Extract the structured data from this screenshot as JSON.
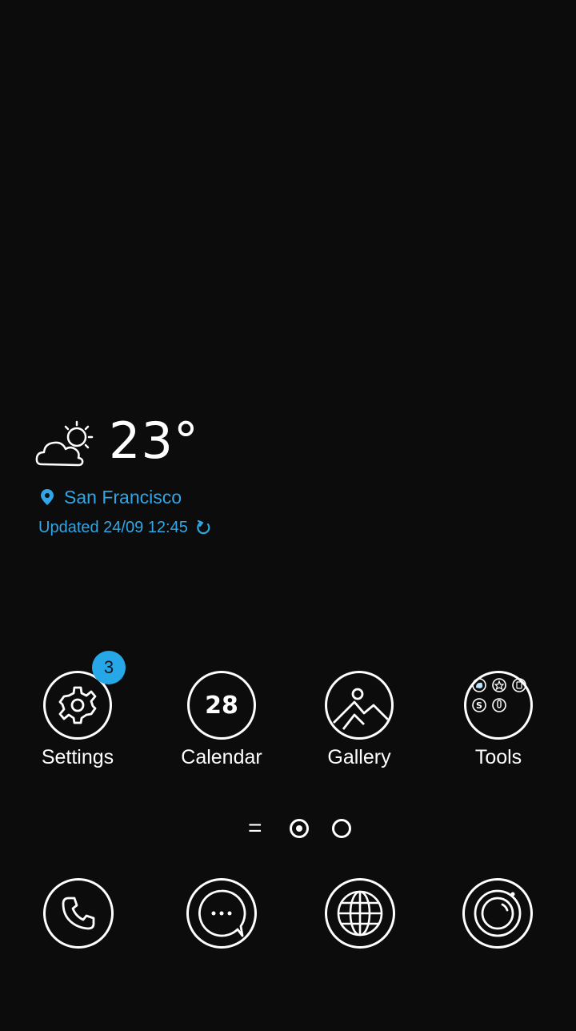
{
  "weather": {
    "temperature": "23°",
    "location": "San Francisco",
    "updated": "Updated 24/09 12:45",
    "accent_color": "#2fa6e6",
    "condition_icon": "partly-cloudy-icon"
  },
  "apps": [
    {
      "label": "Settings",
      "icon": "gear-icon",
      "badge": "3"
    },
    {
      "label": "Calendar",
      "icon": "calendar-icon",
      "date": "28"
    },
    {
      "label": "Gallery",
      "icon": "image-icon"
    },
    {
      "label": "Tools",
      "icon": "folder-icon"
    }
  ],
  "pager": {
    "menu_glyph": "=",
    "pages": 2,
    "active_page": 1
  },
  "dock": [
    {
      "icon": "phone-icon"
    },
    {
      "icon": "messages-icon"
    },
    {
      "icon": "browser-globe-icon"
    },
    {
      "icon": "camera-icon"
    }
  ],
  "colors": {
    "background": "#0c0c0c",
    "badge": "#26a7e8"
  }
}
